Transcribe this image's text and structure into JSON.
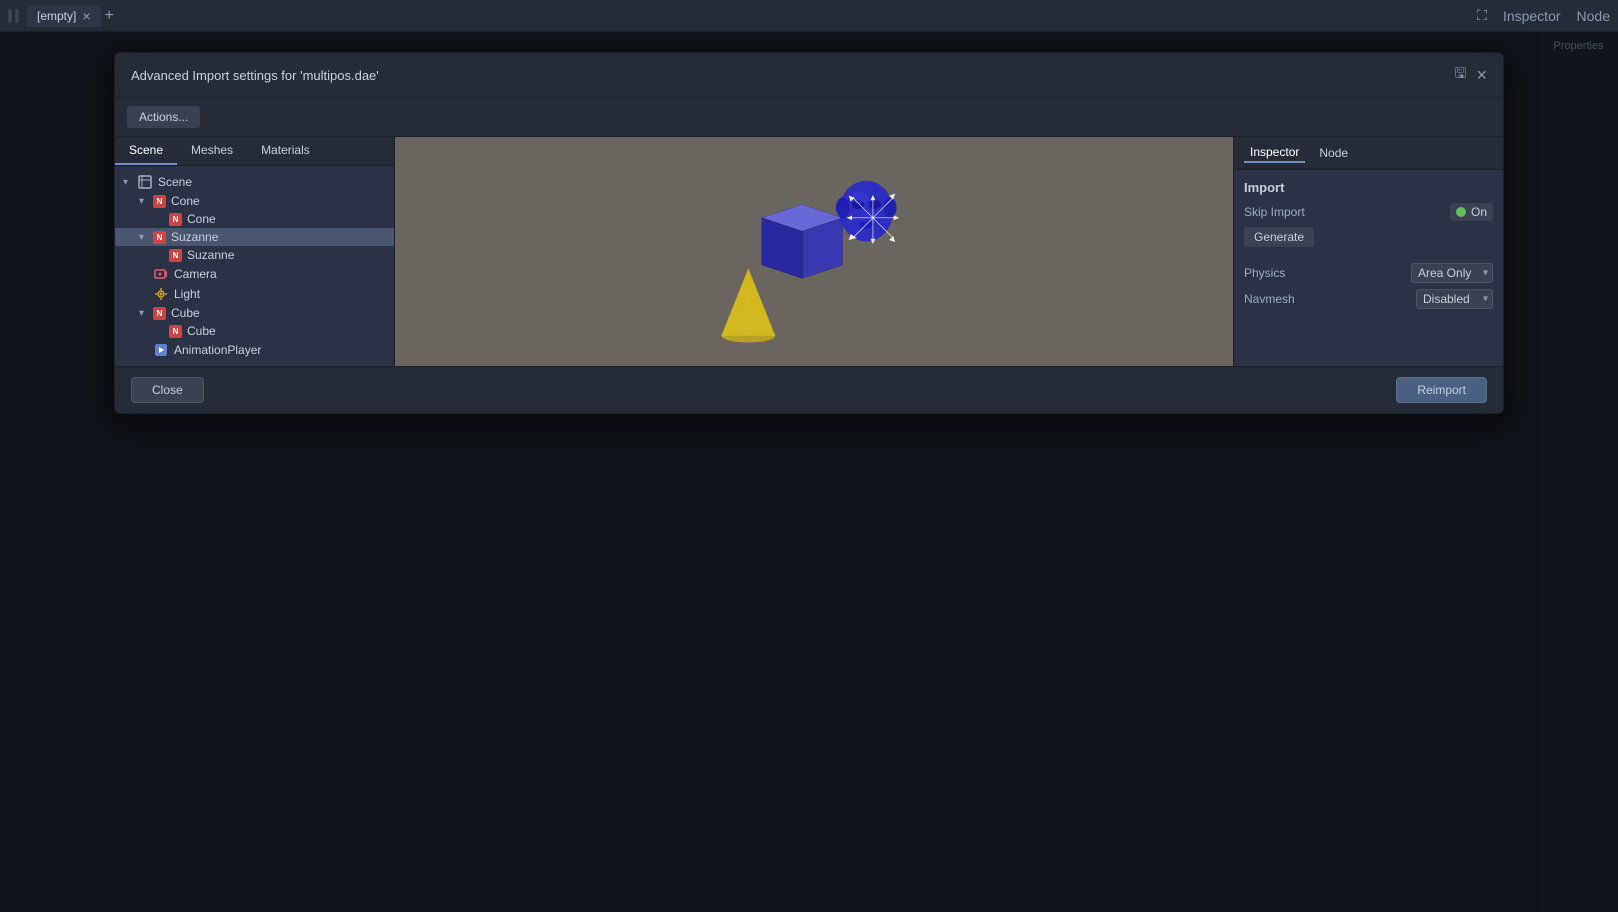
{
  "topbar": {
    "tab_label": "[empty]",
    "add_icon": "+",
    "close_icon": "×",
    "expand_icon": "⛶"
  },
  "modal": {
    "title": "Advanced Import settings for 'multipos.dae'",
    "close_icon": "×",
    "save_icon": "💾",
    "actions_label": "Actions..."
  },
  "scene_tree": {
    "tabs": [
      "Scene",
      "Meshes",
      "Materials"
    ],
    "active_tab": "Scene",
    "items": [
      {
        "id": "scene-root",
        "label": "Scene",
        "level": 0,
        "type": "scene",
        "expanded": true,
        "selected": false
      },
      {
        "id": "cone-group",
        "label": "Cone",
        "level": 1,
        "type": "mesh",
        "expanded": true,
        "selected": false
      },
      {
        "id": "cone-child",
        "label": "Cone",
        "level": 2,
        "type": "mesh",
        "expanded": false,
        "selected": false
      },
      {
        "id": "suzanne-group",
        "label": "Suzanne",
        "level": 1,
        "type": "mesh",
        "expanded": true,
        "selected": true
      },
      {
        "id": "suzanne-child",
        "label": "Suzanne",
        "level": 2,
        "type": "mesh",
        "expanded": false,
        "selected": false
      },
      {
        "id": "camera",
        "label": "Camera",
        "level": 1,
        "type": "camera",
        "expanded": false,
        "selected": false
      },
      {
        "id": "light",
        "label": "Light",
        "level": 1,
        "type": "light",
        "expanded": false,
        "selected": false
      },
      {
        "id": "cube-group",
        "label": "Cube",
        "level": 1,
        "type": "mesh",
        "expanded": true,
        "selected": false
      },
      {
        "id": "cube-child",
        "label": "Cube",
        "level": 2,
        "type": "mesh",
        "expanded": false,
        "selected": false
      },
      {
        "id": "anim-player",
        "label": "AnimationPlayer",
        "level": 1,
        "type": "anim",
        "expanded": false,
        "selected": false
      }
    ]
  },
  "inspector": {
    "tabs": [
      "Inspector",
      "Node"
    ],
    "active_tab": "Inspector",
    "import_section": {
      "title": "Import",
      "skip_import_label": "Skip Import",
      "skip_import_value": "On",
      "generate_label": "Generate",
      "physics_label": "Physics",
      "physics_value": "Area Only",
      "navmesh_label": "Navmesh",
      "navmesh_value": "Disabled"
    }
  },
  "footer": {
    "close_label": "Close",
    "reimport_label": "Reimport"
  },
  "status_bar": {
    "items": [
      "",
      "",
      "",
      ""
    ]
  }
}
